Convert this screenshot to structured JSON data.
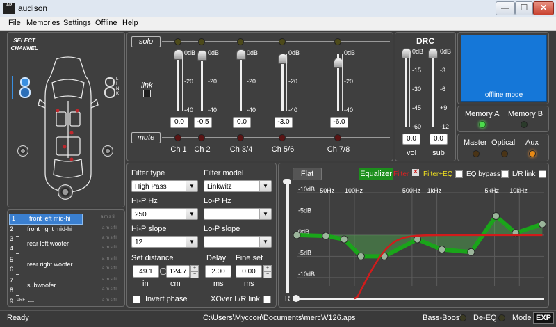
{
  "window": {
    "title": "audison",
    "min_glyph": "—",
    "max_glyph": "☐",
    "close_glyph": "✕",
    "icon_text": "AP"
  },
  "menu": [
    "File",
    "Memories",
    "Settings",
    "Offline",
    "Help"
  ],
  "select_channel": {
    "title": "SELECT\nCHANNEL",
    "link_letter": "L\nI\nN\nK"
  },
  "channels": [
    {
      "num": "1",
      "label": "front left mid-hi",
      "flags": "a m s fil",
      "selected": true
    },
    {
      "num": "2",
      "label": "front right mid-hi",
      "flags": "a m s fil",
      "selected": false
    },
    {
      "num": "3",
      "label": "rear left woofer",
      "flags": "a m s fil",
      "selected": false
    },
    {
      "num": "4",
      "label": "",
      "flags": "a m s fil",
      "selected": false
    },
    {
      "num": "5",
      "label": "rear right woofer",
      "flags": "a m s fil",
      "selected": false
    },
    {
      "num": "6",
      "label": "",
      "flags": "a m s fil",
      "selected": false
    },
    {
      "num": "7",
      "label": "subwoofer",
      "flags": "a m s fil",
      "selected": false
    },
    {
      "num": "8",
      "label": "",
      "flags": "a m s fil",
      "selected": false
    },
    {
      "num": "9",
      "label": "---",
      "flags": "a m s fil",
      "selected": false,
      "prefix": "PRE"
    }
  ],
  "mixer": {
    "solo": "solo",
    "link": "link",
    "mute": "mute",
    "scale": [
      "0dB",
      "-20",
      "-40"
    ],
    "strips": [
      {
        "name": "Ch 1",
        "value": "0.0",
        "level": 0
      },
      {
        "name": "Ch 2",
        "value": "-0.5",
        "level": 0.5
      },
      {
        "name": "Ch 3/4",
        "value": "0.0",
        "level": 0
      },
      {
        "name": "Ch 5/6",
        "value": "-3.0",
        "level": 3
      },
      {
        "name": "Ch 7/8",
        "value": "-6.0",
        "level": 6
      }
    ]
  },
  "drc": {
    "title": "DRC",
    "vol_scale": [
      "0dB",
      "-15",
      "-30",
      "-45",
      "-60"
    ],
    "sub_scale": [
      "0dB",
      "-3",
      "-6",
      "+9",
      "-12"
    ],
    "vol_value": "0.0",
    "sub_value": "0.0",
    "vol_label": "vol",
    "sub_label": "sub"
  },
  "display": {
    "text": "offline mode"
  },
  "memory": {
    "a": "Memory A",
    "b": "Memory B"
  },
  "inputs": {
    "master": "Master",
    "optical": "Optical",
    "aux": "Aux"
  },
  "filter": {
    "type_label": "Filter type",
    "type_value": "High Pass",
    "model_label": "Filter model",
    "model_value": "Linkwitz",
    "hip_hz_label": "Hi-P Hz",
    "hip_hz_value": "250",
    "lop_hz_label": "Lo-P Hz",
    "lop_hz_value": "",
    "hip_slope_label": "Hi-P slope",
    "hip_slope_value": "12",
    "lop_slope_label": "Lo-P slope",
    "lop_slope_value": "",
    "set_distance_label": "Set distance",
    "dist_in": "49.1",
    "dist_cm": "124.7",
    "in_label": "in",
    "cm_label": "cm",
    "delay_label": "Delay",
    "delay_value": "2.00",
    "delay_unit": "ms",
    "fine_label": "Fine set",
    "fine_value": "0.00",
    "fine_unit": "ms",
    "invert_phase": "Invert phase",
    "xover_link": "XOver L/R link"
  },
  "eq": {
    "flat": "Flat",
    "equalizer": "Equalizer",
    "filter": "Filter",
    "filter_eq": "Filter+EQ",
    "eq_bypass": "EQ bypass",
    "lr_link": "L/R link",
    "x_labels": [
      "50Hz",
      "100Hz",
      "500Hz",
      "1kHz",
      "5kHz",
      "10kHz"
    ],
    "y_labels": [
      "-10dB",
      "-5dB",
      "0dB",
      "-5dB",
      "-10dB"
    ],
    "r_label": "R",
    "curve_color": "#1aa51a",
    "filter_color": "#d11b1b"
  },
  "status": {
    "ready": "Ready",
    "path": "C:\\Users\\Муссон\\Documents\\mercW126.aps",
    "bass_boost": "Bass-Boost",
    "de_eq": "De-EQ",
    "mode": "Mode",
    "exp": "EXP"
  }
}
